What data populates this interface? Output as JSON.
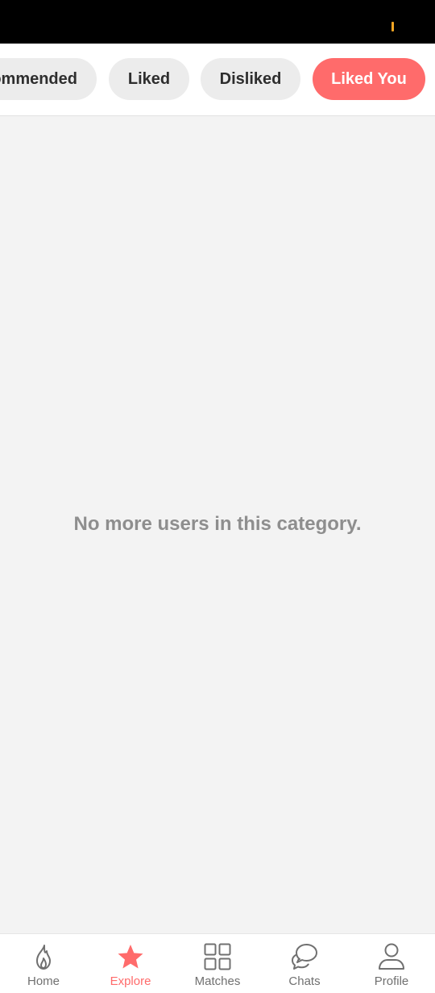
{
  "colors": {
    "accent": "#ff6b6b",
    "status_indicator": "#f5a623",
    "chip_bg": "#ececec",
    "nav_inactive": "#707070"
  },
  "tabs": [
    {
      "label": "Recommended",
      "visible_label": "ommended",
      "active": false
    },
    {
      "label": "Liked",
      "visible_label": "Liked",
      "active": false
    },
    {
      "label": "Disliked",
      "visible_label": "Disliked",
      "active": false
    },
    {
      "label": "Liked You",
      "visible_label": "Liked You",
      "active": true
    }
  ],
  "main": {
    "empty_message": "No more users in this category."
  },
  "bottom_nav": {
    "items": [
      {
        "label": "Home",
        "icon": "flame-icon",
        "active": false
      },
      {
        "label": "Explore",
        "icon": "star-icon",
        "active": true
      },
      {
        "label": "Matches",
        "icon": "grid-icon",
        "active": false
      },
      {
        "label": "Chats",
        "icon": "chat-bubbles-icon",
        "active": false
      },
      {
        "label": "Profile",
        "icon": "person-icon",
        "active": false
      }
    ]
  }
}
